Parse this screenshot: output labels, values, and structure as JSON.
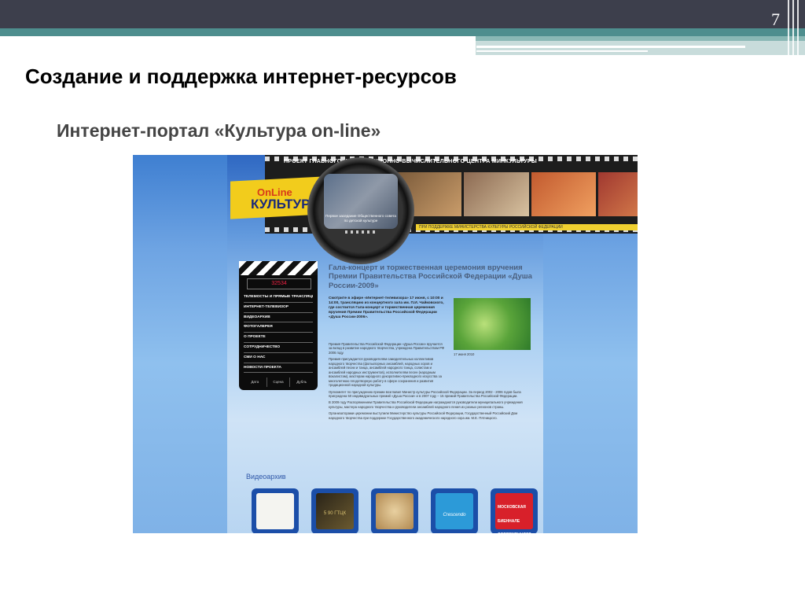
{
  "slide": {
    "number": "7",
    "title": "Создание и поддержка интернет-ресурсов",
    "subtitle": "Интернет-портал «Культура on-line»"
  },
  "site": {
    "project_banner": "ПРОЕКТ ГЛАВНОГО ИНФОРМАЦИОННО-ВЫЧИСЛИТЕЛЬНОГО ЦЕНТРА МИНКУЛЬТУРЫ",
    "logo_line1": "OnLine",
    "logo_line2": "КУЛЬТУРА",
    "lens_caption": "Первое заседание Общественного совета по детской культуре",
    "ticker": "ПРИ ПОДДЕРЖКЕ МИНИСТЕРСТВА КУЛЬТУРЫ РОССИЙСКОЙ ФЕДЕРАЦИИ",
    "counter": "32534",
    "menu": [
      "ТЕЛЕМОСТЫ И ПРЯМЫЕ ТРАНСЛЯЦИИ",
      "ИНТЕРНЕТ-ТЕЛЕВИЗОР",
      "ВИДЕОАРХИВ",
      "ФОТОГАЛЕРЕЯ",
      "О ПРОЕКТЕ",
      "СОТРУДНИЧЕСТВО",
      "СМИ О НАС",
      "НОВОСТИ ПРОЕКТА"
    ],
    "clap_bottom": [
      "Дата",
      "Сцена",
      "Дубль"
    ],
    "article_title": "Гала-концерт и торжественная церемония вручения Премии Правительства Российской Федерации «Душа России-2009»",
    "article_intro": "Смотрите в эфире «Интернет-телевизора» 17 июня, с 10:00 и 14:00, трансляцию из концертного зала им. П.И. Чайковского, где состоится Гала-концерт и торжественная церемония вручения Премии Правительства Российской Федерации «Душа России-2006».",
    "green_caption": "17 июня 2010",
    "body_paragraphs": [
      "Премия Правительства Российской Федерации «Душа России» вручается за вклад в развитие народного творчества, учреждена Правительством РФ 2006 году.",
      "Премия присуждается руководителям самодеятельных коллективов народного творчества (фольклорных ансамблей, народных хоров и ансамблей песни и танца, ансамблей народного танца, солистам и ансамблей народных инструментов), исполнителям песен (народным вокалистам), мастерам народного декоративно-прикладного искусства за многолетнюю плодотворную работу в сфере сохранения и развития традиционной народной культуры.",
      "Оргкомитет по присуждению премии возглавил Министр культуры Российской Федерации. За период 2002 - 2006 годов была присуждена 50 индивидуальных премий «Душа России» и в 2007 году – 15 премий Правительства Российской Федерации.",
      "В 2009 году Распоряжением Правительства Российской Федерации награждаются руководители муниципального учреждения культуры, мастера народного творчества и руководители ансамблей народного пения из разных регионов страны.",
      "Организаторами церемонии выступили Министерство культуры Российской Федерации, Государственный Российский Дом народного творчества при поддержке Государственного академического народного хора им. М.Е. Пятницкого."
    ],
    "video_archive_label": "Видеоархив",
    "video_tiles": [
      {
        "label": ""
      },
      {
        "label": "5 90 ГТЦК"
      },
      {
        "label": ""
      },
      {
        "label": "Crescendo"
      },
      {
        "label": "МОСКОВСКАЯ БИЕННАЛЕ СОВРЕМЕННОГО ИСКУССТВА"
      }
    ]
  },
  "colors": {
    "header_dark": "#3d3f4c",
    "header_teal": "#4e8e8e",
    "site_blue": "#3f7fd1"
  }
}
